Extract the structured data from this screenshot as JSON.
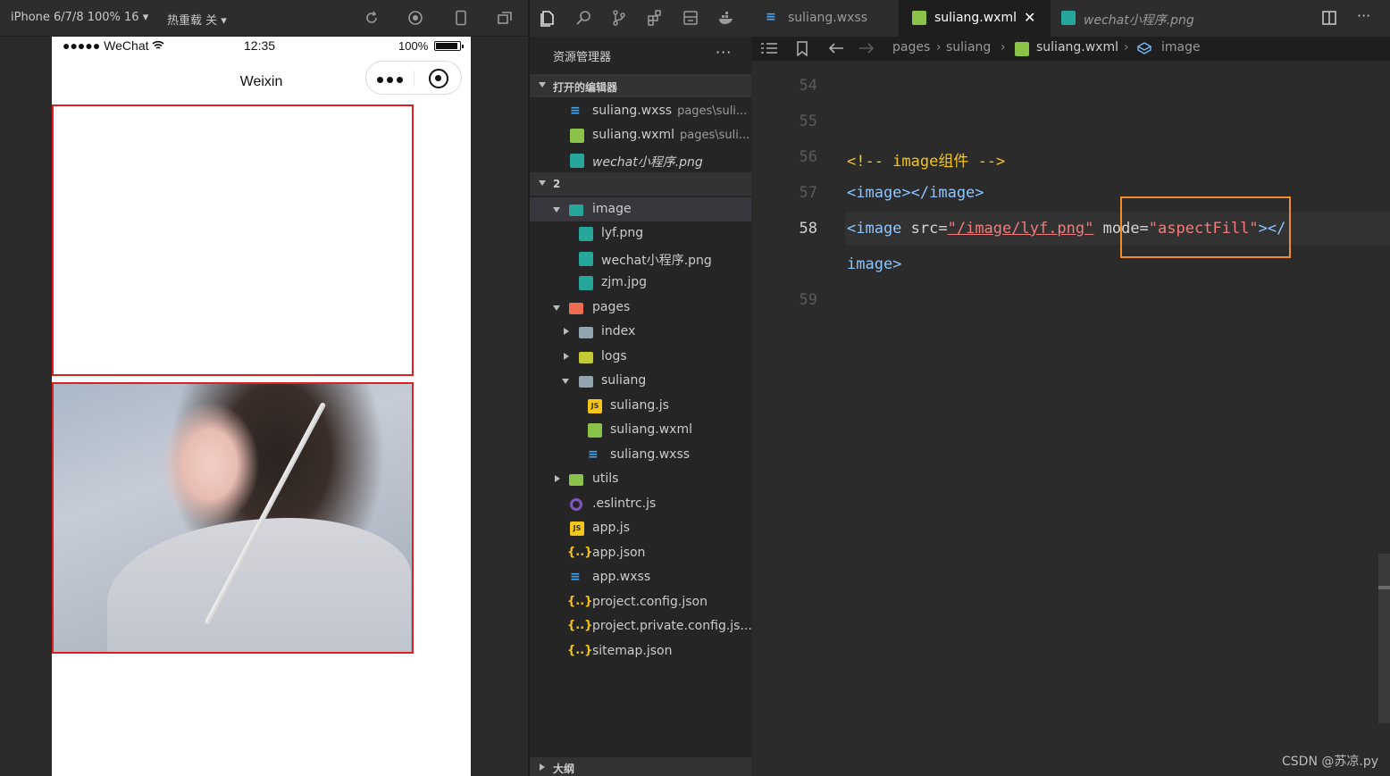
{
  "simulator": {
    "device_label": "iPhone 6/7/8 100% 16 ▾",
    "hot_reload_label": "热重载 关 ▾",
    "status": {
      "carrier": "●●●●● WeChat",
      "time": "12:35",
      "battery": "100%"
    },
    "nav_title": "Weixin"
  },
  "explorer": {
    "title": "资源管理器",
    "more": "···",
    "open_editors_header": "打开的编辑器",
    "open_editors": [
      {
        "name": "suliang.wxss",
        "path": "pages\\suli...",
        "icon": "wxss-icon"
      },
      {
        "name": "suliang.wxml",
        "path": "pages\\suli...",
        "icon": "wxml-icon"
      },
      {
        "name": "wechat小程序.png",
        "path": "",
        "icon": "png-icon"
      }
    ],
    "project_header": "2",
    "tree": {
      "image": "image",
      "lyf": "lyf.png",
      "wechat_png": "wechat小程序.png",
      "zjm": "zjm.jpg",
      "pages": "pages",
      "index": "index",
      "logs": "logs",
      "suliang": "suliang",
      "suliang_js": "suliang.js",
      "suliang_wxml": "suliang.wxml",
      "suliang_wxss": "suliang.wxss",
      "utils": "utils",
      "eslintrc": ".eslintrc.js",
      "app_js": "app.js",
      "app_json": "app.json",
      "app_wxss": "app.wxss",
      "project_config": "project.config.json",
      "project_private": "project.private.config.js...",
      "sitemap": "sitemap.json"
    },
    "outline_header": "大纲"
  },
  "editor": {
    "tabs": [
      {
        "label": "suliang.wxss",
        "icon": "wxss-icon",
        "active": false
      },
      {
        "label": "suliang.wxml",
        "icon": "wxml-icon",
        "active": true,
        "close": "✕"
      },
      {
        "label": "wechat小程序.png",
        "icon": "png-icon",
        "active": false
      }
    ],
    "breadcrumb": [
      "pages",
      "suliang",
      "suliang.wxml",
      "image"
    ],
    "lines": {
      "n54": "54",
      "n55": "55",
      "n56": "56",
      "n57": "57",
      "n58": "58",
      "n59": "59",
      "comment": "<!-- image组件 -->",
      "l57": "<image></image>",
      "l58_open": "<image",
      "l58_src_attr": " src=",
      "l58_src_val": "\"/image/lyf.png\"",
      "l58_mode_attr": " mode=",
      "l58_mode_q1": "\"",
      "l58_mode_val": "aspectFill",
      "l58_mode_q2": "\"",
      "l58_close": "></",
      "l58_wrap": "image>"
    }
  },
  "watermark": "CSDN @苏凉.py",
  "colors": {
    "image_border": "#e02020",
    "highlight_box": "#f28c28",
    "tag": "#8fc5ff",
    "string": "#f47c7c",
    "comment": "#f5c518"
  }
}
